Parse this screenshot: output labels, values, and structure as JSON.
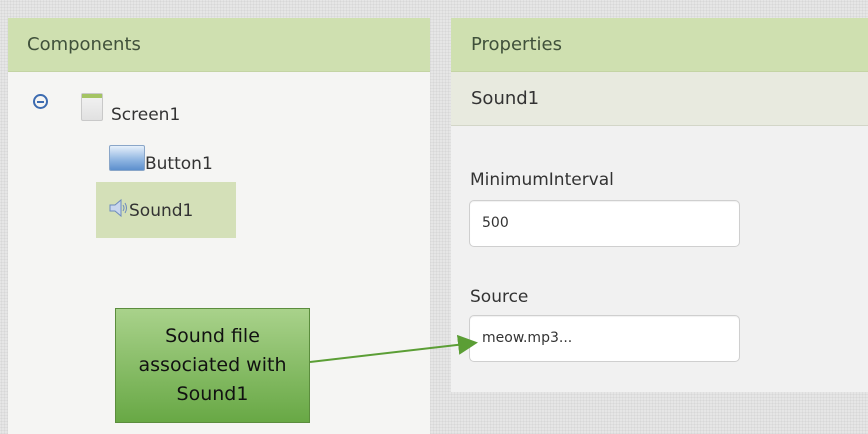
{
  "components_panel": {
    "title": "Components",
    "tree": {
      "screen": "Screen1",
      "children": [
        "Button1",
        "Sound1"
      ]
    }
  },
  "properties_panel": {
    "title": "Properties",
    "selected_component": "Sound1",
    "fields": [
      {
        "label": "MinimumInterval",
        "value": "500"
      },
      {
        "label": "Source",
        "value": "meow.mp3..."
      }
    ]
  },
  "annotation": {
    "lines": [
      "Sound file",
      "associated with",
      "Sound1"
    ]
  },
  "colors": {
    "header_bg": "#cfe0b0",
    "selection_bg": "#d4e0b8",
    "callout_bg": "#68a845",
    "arrow": "#5b9e35"
  }
}
